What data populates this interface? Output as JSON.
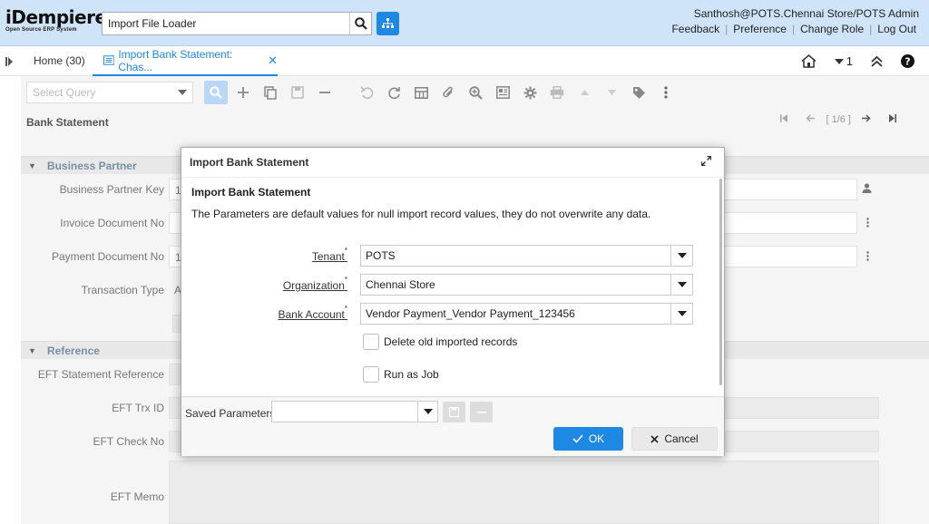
{
  "header": {
    "logo_text": "iDempiere",
    "logo_subtitle": "Open Source ERP System",
    "search_value": "Import File Loader",
    "user": "Santhosh@POTS.Chennai Store/POTS Admin",
    "links": [
      "Feedback",
      "Preference",
      "Change Role",
      "Log Out"
    ]
  },
  "tabs": {
    "home_label": "Home (30)",
    "active_label": "Import Bank Statement: Chas...",
    "close_glyph": "✕",
    "counter": "1"
  },
  "toolbar": {
    "query_placeholder": "Select Query"
  },
  "window": {
    "title": "Bank Statement",
    "record_position": "[ 1/6 ]",
    "sections": [
      {
        "label": "Business Partner"
      },
      {
        "label": "Reference"
      }
    ],
    "fields": [
      {
        "label": "Business Partner Key",
        "value": "1"
      },
      {
        "label": "Invoice Document No",
        "value": ""
      },
      {
        "label": "Payment Document No",
        "value": "1"
      },
      {
        "label": "Transaction Type",
        "value": "A"
      },
      {
        "label": "EFT Statement Reference",
        "value": ""
      },
      {
        "label": "EFT Trx ID",
        "value": ""
      },
      {
        "label": "EFT Check No",
        "value": ""
      },
      {
        "label": "EFT Memo",
        "value": ""
      }
    ]
  },
  "dialog": {
    "title": "Import Bank Statement",
    "process_title": "Import Bank Statement",
    "description": "The Parameters are default values for null import record values, they do not overwrite any data.",
    "required_mark": "*",
    "params": [
      {
        "label": "Tenant",
        "value": "POTS"
      },
      {
        "label": "Organization",
        "value": "Chennai Store"
      },
      {
        "label": "Bank Account",
        "value": "Vendor Payment_Vendor Payment_123456"
      }
    ],
    "checkboxes": [
      {
        "label": "Delete old imported records",
        "checked": false
      },
      {
        "label": "Run as Job",
        "checked": false
      }
    ],
    "saved_params_label": "Saved Parameters",
    "ok_label": "OK",
    "cancel_label": "Cancel"
  },
  "colors": {
    "accent": "#1e88e5",
    "header_bg": "#cfe4f8"
  }
}
